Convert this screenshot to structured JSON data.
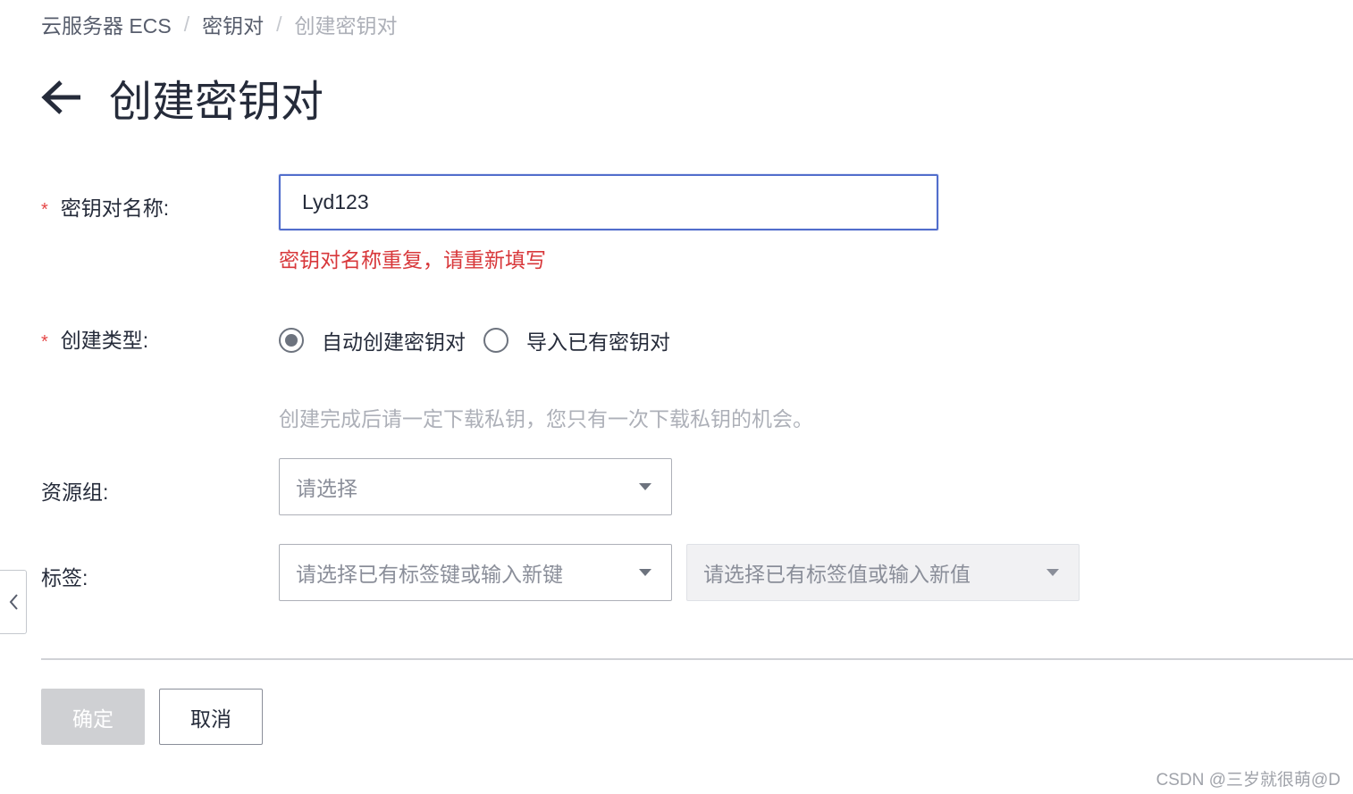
{
  "breadcrumb": {
    "items": [
      "云服务器 ECS",
      "密钥对",
      "创建密钥对"
    ],
    "separator": "/"
  },
  "page": {
    "title": "创建密钥对",
    "back_icon": "arrow-left-icon"
  },
  "form": {
    "name": {
      "required_mark": "*",
      "label": "密钥对名称:",
      "value": "Lyd123",
      "error": "密钥对名称重复，请重新填写"
    },
    "create_type": {
      "required_mark": "*",
      "label": "创建类型:",
      "options": [
        "自动创建密钥对",
        "导入已有密钥对"
      ],
      "selected": "自动创建密钥对",
      "hint": "创建完成后请一定下载私钥，您只有一次下载私钥的机会。"
    },
    "resource_group": {
      "label": "资源组:",
      "placeholder": "请选择"
    },
    "tags": {
      "label": "标签:",
      "key_placeholder": "请选择已有标签键或输入新键",
      "value_placeholder": "请选择已有标签值或输入新值"
    }
  },
  "actions": {
    "confirm": "确定",
    "cancel": "取消"
  },
  "watermark": "CSDN @三岁就很萌@D",
  "colors": {
    "accent": "#526ecc",
    "error": "#d8383b",
    "required": "#e54545",
    "disabled_button": "#cfd0d3"
  }
}
